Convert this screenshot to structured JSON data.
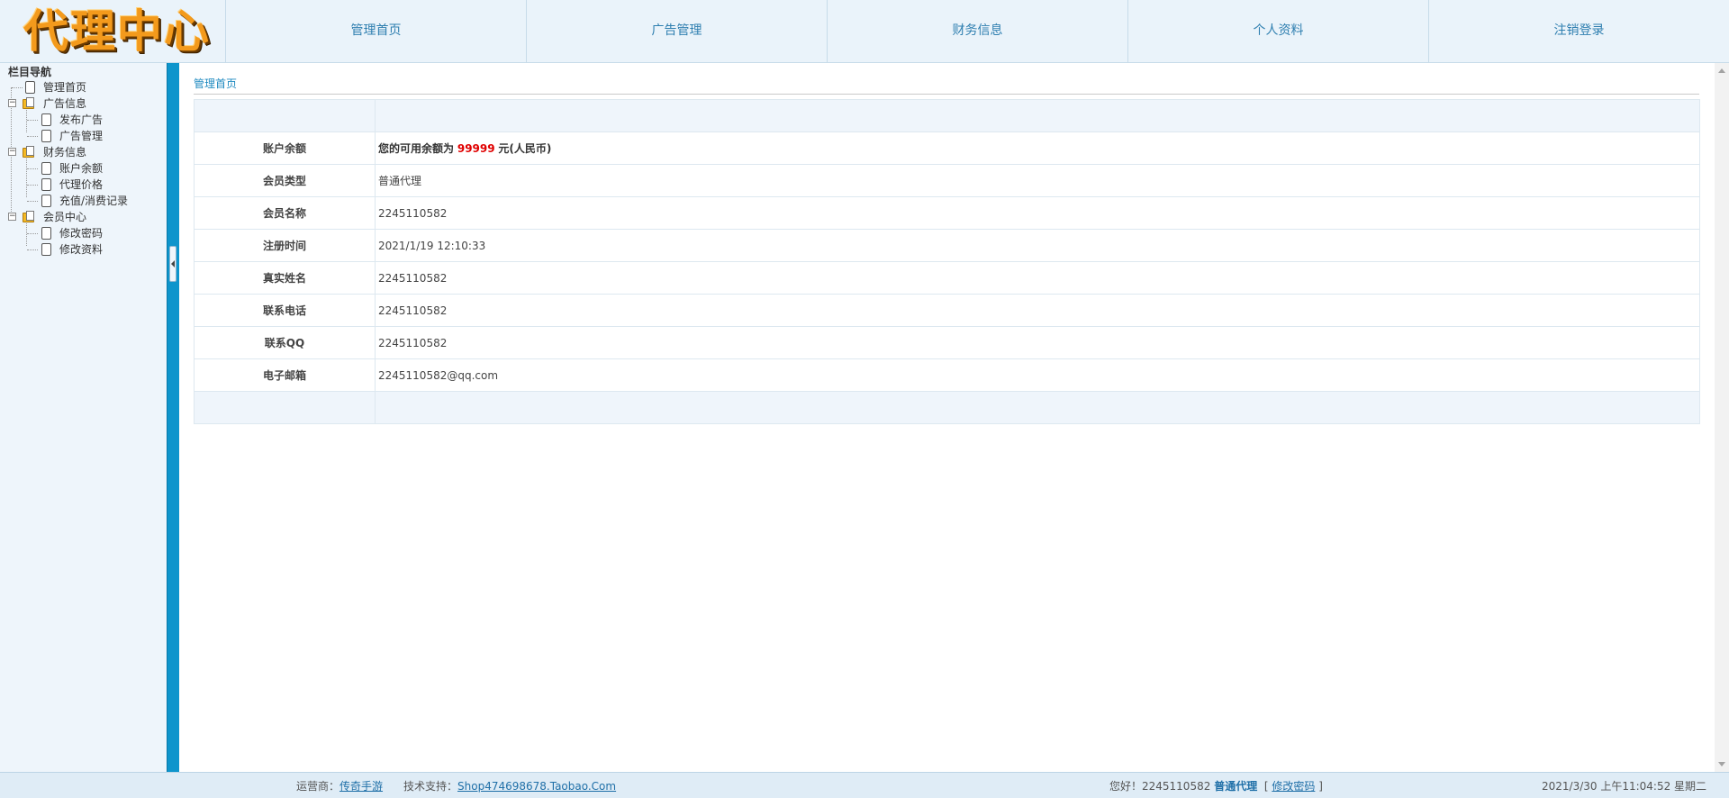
{
  "header": {
    "logo_text": "代理中心",
    "nav": [
      {
        "label": "管理首页"
      },
      {
        "label": "广告管理"
      },
      {
        "label": "财务信息"
      },
      {
        "label": "个人资料"
      },
      {
        "label": "注销登录"
      }
    ]
  },
  "sidebar": {
    "title": "栏目导航",
    "tree": {
      "home": "管理首页",
      "ads": {
        "label": "广告信息",
        "children": [
          "发布广告",
          "广告管理"
        ]
      },
      "finance": {
        "label": "财务信息",
        "children": [
          "账户余额",
          "代理价格",
          "充值/消费记录"
        ]
      },
      "member": {
        "label": "会员中心",
        "children": [
          "修改密码",
          "修改资料"
        ]
      }
    }
  },
  "main": {
    "page_title": "管理首页",
    "balance": {
      "label": "账户余额",
      "prefix": "您的可用余额为",
      "amount": "99999",
      "suffix": "元(人民币)"
    },
    "rows": [
      {
        "label": "会员类型",
        "value": "普通代理"
      },
      {
        "label": "会员名称",
        "value": "2245110582"
      },
      {
        "label": "注册时间",
        "value": "2021/1/19 12:10:33"
      },
      {
        "label": "真实姓名",
        "value": "2245110582"
      },
      {
        "label": "联系电话",
        "value": "2245110582"
      },
      {
        "label": "联系QQ",
        "value": "2245110582"
      },
      {
        "label": "电子邮箱",
        "value": "2245110582@qq.com"
      }
    ]
  },
  "footer": {
    "operator_label": "运营商：",
    "operator_link": "传奇手游",
    "support_label": "技术支持：",
    "support_link": "Shop474698678.Taobao.Com",
    "greeting": "您好！2245110582",
    "role": "普通代理",
    "bracket_open": "[",
    "change_pwd": "修改密码",
    "bracket_close": "]",
    "datetime": "2021/3/30 上午11:04:52 星期二"
  },
  "colors": {
    "accent": "#0e95cc",
    "nav_text": "#2f7fb0",
    "balance_amount": "#e00000",
    "logo": "#f39a1c"
  }
}
